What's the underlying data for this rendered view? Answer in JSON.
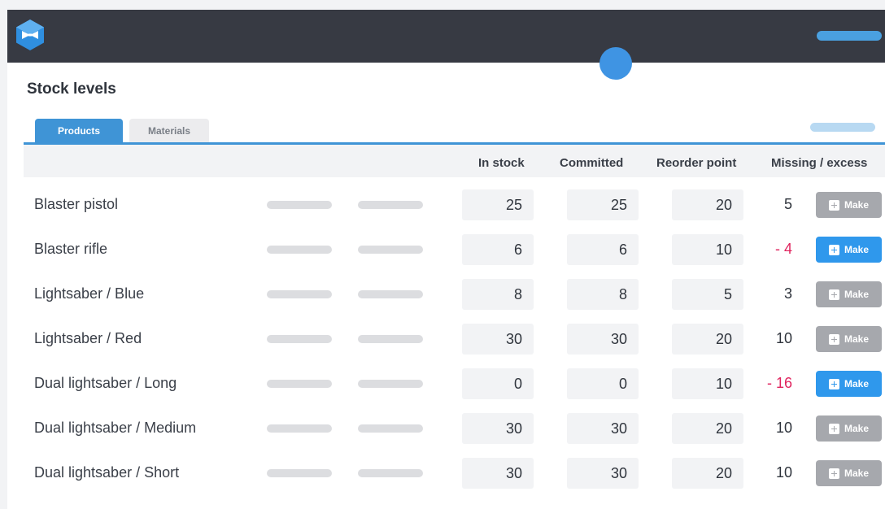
{
  "header": {
    "logo_icon": "bow-tie-hexagon-icon",
    "avatar_color": "#3f94e3"
  },
  "page": {
    "title": "Stock levels"
  },
  "tabs": [
    {
      "label": "Products",
      "active": true
    },
    {
      "label": "Materials",
      "active": false
    }
  ],
  "table": {
    "columns": {
      "in_stock": "In stock",
      "committed": "Committed",
      "reorder_point": "Reorder point",
      "missing_excess": "Missing / excess"
    },
    "make_label": "Make",
    "rows": [
      {
        "name": "Blaster pistol",
        "in_stock": "25",
        "committed": "25",
        "reorder_point": "20",
        "diff": "5",
        "shortage": false
      },
      {
        "name": "Blaster rifle",
        "in_stock": "6",
        "committed": "6",
        "reorder_point": "10",
        "diff": "- 4",
        "shortage": true
      },
      {
        "name": "Lightsaber / Blue",
        "in_stock": "8",
        "committed": "8",
        "reorder_point": "5",
        "diff": "3",
        "shortage": false
      },
      {
        "name": "Lightsaber / Red",
        "in_stock": "30",
        "committed": "30",
        "reorder_point": "20",
        "diff": "10",
        "shortage": false
      },
      {
        "name": "Dual lightsaber / Long",
        "in_stock": "0",
        "committed": "0",
        "reorder_point": "10",
        "diff": "- 16",
        "shortage": true
      },
      {
        "name": "Dual lightsaber / Medium",
        "in_stock": "30",
        "committed": "30",
        "reorder_point": "20",
        "diff": "10",
        "shortage": false
      },
      {
        "name": "Dual lightsaber / Short",
        "in_stock": "30",
        "committed": "30",
        "reorder_point": "20",
        "diff": "10",
        "shortage": false
      }
    ]
  },
  "colors": {
    "accent": "#3f94d6",
    "make_active": "#2f98ec",
    "make_inactive": "#a6a8ad",
    "negative": "#e0245e"
  }
}
